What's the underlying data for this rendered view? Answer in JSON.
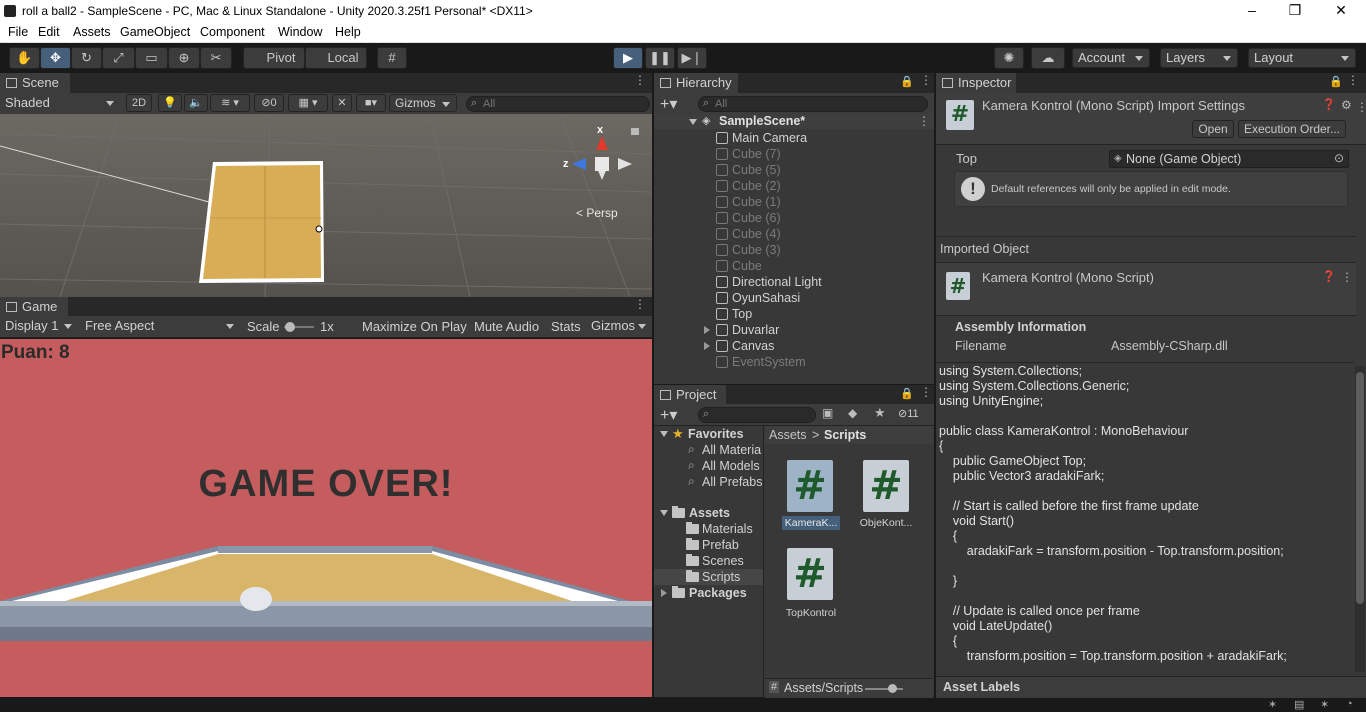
{
  "window": {
    "title": "roll a ball2 - SampleScene - PC, Mac & Linux Standalone - Unity 2020.3.25f1 Personal* <DX11>"
  },
  "menu": [
    "File",
    "Edit",
    "Assets",
    "GameObject",
    "Component",
    "Window",
    "Help"
  ],
  "toolbar": {
    "pivot": "Pivot",
    "local": "Local",
    "account": "Account",
    "layers": "Layers",
    "layout": "Layout"
  },
  "scene": {
    "tab": "Scene",
    "shading": "Shaded",
    "mode2d": "2D",
    "hidden_count": "0",
    "gizmos": "Gizmos",
    "search_placeholder": "All",
    "persp": "Persp",
    "axis_x": "x",
    "axis_z": "z"
  },
  "game": {
    "tab": "Game",
    "display": "Display 1",
    "aspect": "Free Aspect",
    "scale_label": "Scale",
    "scale_value": "1x",
    "maximize": "Maximize On Play",
    "mute": "Mute Audio",
    "stats": "Stats",
    "gizmos": "Gizmos",
    "score": "Puan: 8",
    "game_over": "GAME OVER!"
  },
  "hierarchy": {
    "tab": "Hierarchy",
    "search_placeholder": "All",
    "scene_name": "SampleScene*",
    "items": [
      {
        "label": "Main Camera",
        "dim": false,
        "expand": false
      },
      {
        "label": "Cube (7)",
        "dim": true,
        "expand": false
      },
      {
        "label": "Cube (5)",
        "dim": true,
        "expand": false
      },
      {
        "label": "Cube (2)",
        "dim": true,
        "expand": false
      },
      {
        "label": "Cube (1)",
        "dim": true,
        "expand": false
      },
      {
        "label": "Cube (6)",
        "dim": true,
        "expand": false
      },
      {
        "label": "Cube (4)",
        "dim": true,
        "expand": false
      },
      {
        "label": "Cube (3)",
        "dim": true,
        "expand": false
      },
      {
        "label": "Cube",
        "dim": true,
        "expand": false
      },
      {
        "label": "Directional Light",
        "dim": false,
        "expand": false
      },
      {
        "label": "OyunSahasi",
        "dim": false,
        "expand": false
      },
      {
        "label": "Top",
        "dim": false,
        "expand": false
      },
      {
        "label": "Duvarlar",
        "dim": false,
        "expand": true
      },
      {
        "label": "Canvas",
        "dim": false,
        "expand": true
      },
      {
        "label": "EventSystem",
        "dim": true,
        "expand": false
      }
    ]
  },
  "project": {
    "tab": "Project",
    "hidden_count": "11",
    "favorites": "Favorites",
    "fav_items": [
      "All Materia",
      "All Models",
      "All Prefabs"
    ],
    "assets": "Assets",
    "asset_folders": [
      "Materials",
      "Prefab",
      "Scenes",
      "Scripts"
    ],
    "packages": "Packages",
    "breadcrumb_root": "Assets",
    "breadcrumb_sep": ">",
    "breadcrumb_current": "Scripts",
    "files": [
      "KameraK...",
      "ObjeKont...",
      "TopKontrol"
    ],
    "footer_path": "Assets/Scripts"
  },
  "inspector": {
    "tab": "Inspector",
    "header_title": "Kamera Kontrol (Mono Script) Import Settings",
    "open": "Open",
    "execution_order": "Execution Order...",
    "field_label": "Top",
    "field_value": "None (Game Object)",
    "info": "Default references will only be applied in edit mode.",
    "imported_object": "Imported Object",
    "imported_title": "Kamera Kontrol (Mono Script)",
    "assembly_info": "Assembly Information",
    "filename_label": "Filename",
    "filename_value": "Assembly-CSharp.dll",
    "code": "using System.Collections;\nusing System.Collections.Generic;\nusing UnityEngine;\n\npublic class KameraKontrol : MonoBehaviour\n{\n    public GameObject Top;\n    public Vector3 aradakiFark;\n\n    // Start is called before the first frame update\n    void Start()\n    {\n        aradakiFark = transform.position - Top.transform.position;\n\n    }\n\n    // Update is called once per frame\n    void LateUpdate()\n    {\n        transform.position = Top.transform.position + aradakiFark;",
    "asset_labels": "Asset Labels"
  },
  "colors": {
    "accent": "#46607c",
    "game_bg": "#c55c5e",
    "board": "#e1b65f"
  }
}
